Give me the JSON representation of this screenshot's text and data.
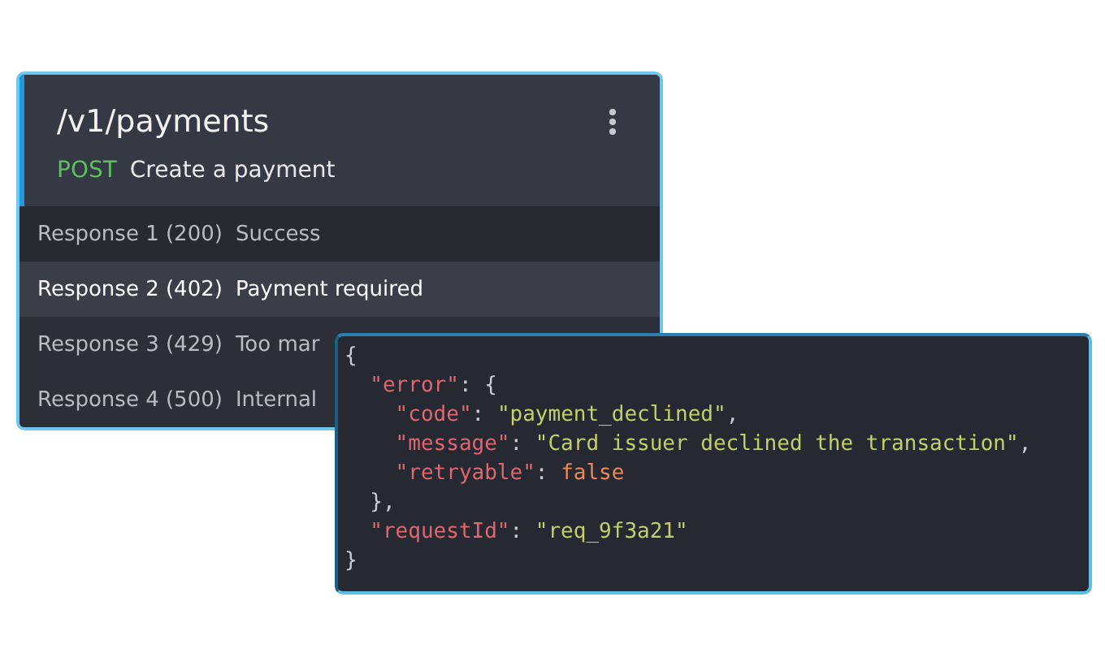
{
  "endpoint": {
    "path": "/v1/payments",
    "method": "POST",
    "summary": "Create a payment"
  },
  "responses": [
    {
      "label": "Response 1 (200)",
      "description": "Success",
      "selected": false
    },
    {
      "label": "Response 2 (402)",
      "description": "Payment required",
      "selected": true
    },
    {
      "label": "Response 3 (429)",
      "description": "Too mar",
      "selected": false
    },
    {
      "label": "Response 4 (500)",
      "description": "Internal",
      "selected": false
    }
  ],
  "code_lines": [
    [
      {
        "kind": "punct",
        "text": "{"
      }
    ],
    [
      {
        "kind": "key",
        "text": "  \"error\""
      },
      {
        "kind": "punct",
        "text": ": {"
      }
    ],
    [
      {
        "kind": "key",
        "text": "    \"code\""
      },
      {
        "kind": "punct",
        "text": ": "
      },
      {
        "kind": "string",
        "text": "\"payment_declined\""
      },
      {
        "kind": "punct",
        "text": ","
      }
    ],
    [
      {
        "kind": "key",
        "text": "    \"message\""
      },
      {
        "kind": "punct",
        "text": ": "
      },
      {
        "kind": "string",
        "text": "\"Card issuer declined the transaction\""
      },
      {
        "kind": "punct",
        "text": ","
      }
    ],
    [
      {
        "kind": "key",
        "text": "    \"retryable\""
      },
      {
        "kind": "punct",
        "text": ": "
      },
      {
        "kind": "literal",
        "text": "false"
      }
    ],
    [
      {
        "kind": "punct",
        "text": "  },"
      }
    ],
    [
      {
        "kind": "key",
        "text": "  \"requestId\""
      },
      {
        "kind": "punct",
        "text": ": "
      },
      {
        "kind": "string",
        "text": "\"req_9f3a21\""
      }
    ],
    [
      {
        "kind": "punct",
        "text": "}"
      }
    ]
  ]
}
